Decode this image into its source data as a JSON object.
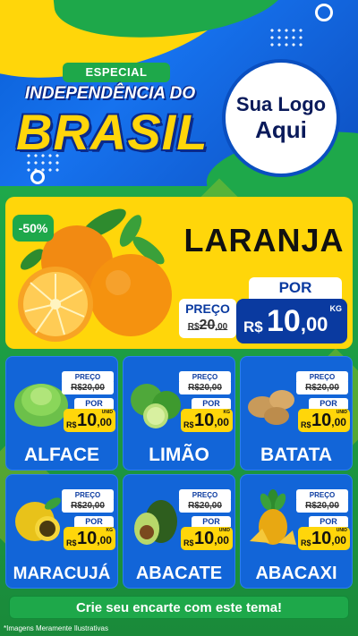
{
  "header": {
    "especial": "ESPECIAL",
    "title_line1": "INDEPENDÊNCIA DO",
    "title_line2": "BRASIL",
    "logo_line1": "Sua Logo",
    "logo_line2": "Aqui"
  },
  "featured": {
    "discount": "-50%",
    "name": "LARANJA",
    "preco_label": "PREÇO",
    "old_currency": "R$",
    "old_value": "20",
    "old_cents": ",00",
    "por_label": "POR",
    "new_currency": "R$",
    "new_value": "10",
    "new_cents": ",00",
    "unit": "KG"
  },
  "products": [
    {
      "name": "ALFACE",
      "preco_label": "PREÇO",
      "old": "R$20,00",
      "por_label": "POR",
      "currency": "R$",
      "value": "10",
      "cents": ",00",
      "unit": "UNID"
    },
    {
      "name": "LIMÃO",
      "preco_label": "PREÇO",
      "old": "R$20,00",
      "por_label": "POR",
      "currency": "R$",
      "value": "10",
      "cents": ",00",
      "unit": "KG"
    },
    {
      "name": "BATATA",
      "preco_label": "PREÇO",
      "old": "R$20,00",
      "por_label": "POR",
      "currency": "R$",
      "value": "10",
      "cents": ",00",
      "unit": "UNID"
    },
    {
      "name": "MARACUJÁ",
      "preco_label": "PREÇO",
      "old": "R$20,00",
      "por_label": "POR",
      "currency": "R$",
      "value": "10",
      "cents": ",00",
      "unit": "KG"
    },
    {
      "name": "ABACATE",
      "preco_label": "PREÇO",
      "old": "R$20,00",
      "por_label": "POR",
      "currency": "R$",
      "value": "10",
      "cents": ",00",
      "unit": "UNID"
    },
    {
      "name": "ABACAXI",
      "preco_label": "PREÇO",
      "old": "R$20,00",
      "por_label": "POR",
      "currency": "R$",
      "value": "10",
      "cents": ",00",
      "unit": "UNID"
    }
  ],
  "footer": {
    "cta": "Crie seu encarte com este tema!",
    "disclaimer": "*Imagens Meramente Ilustrativas"
  },
  "colors": {
    "blue": "#0a5fd6",
    "green": "#1ea84a",
    "yellow": "#ffd60a"
  }
}
